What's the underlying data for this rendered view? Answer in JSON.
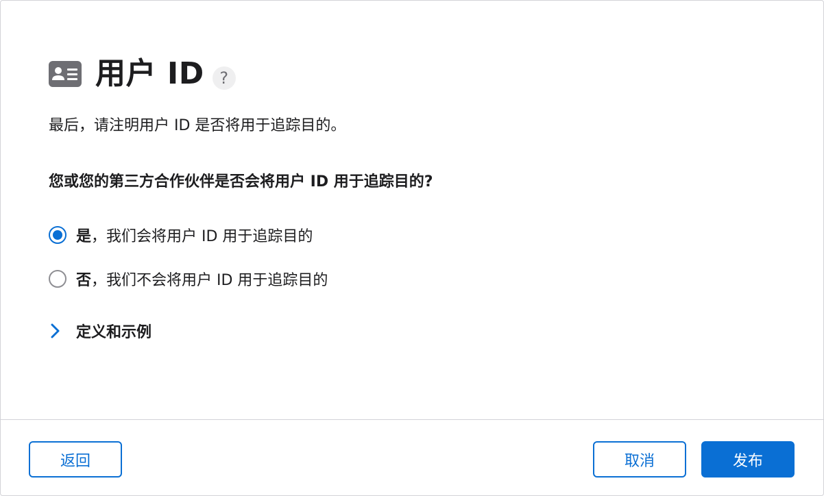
{
  "header": {
    "title": "用户 ID",
    "help_label": "?"
  },
  "intro": "最后，请注明用户 ID 是否将用于追踪目的。",
  "question": "您或您的第三方合作伙伴是否会将用户 ID 用于追踪目的?",
  "options": [
    {
      "strong": "是",
      "rest": "，我们会将用户 ID 用于追踪目的",
      "selected": true
    },
    {
      "strong": "否",
      "rest": "，我们不会将用户 ID 用于追踪目的",
      "selected": false
    }
  ],
  "disclosure": {
    "label": "定义和示例",
    "icon": "chevron-right-icon"
  },
  "footer": {
    "back_label": "返回",
    "cancel_label": "取消",
    "publish_label": "发布"
  },
  "colors": {
    "accent": "#0a6fd4",
    "icon_gray": "#6e6e73",
    "divider": "#d2d2d7"
  }
}
